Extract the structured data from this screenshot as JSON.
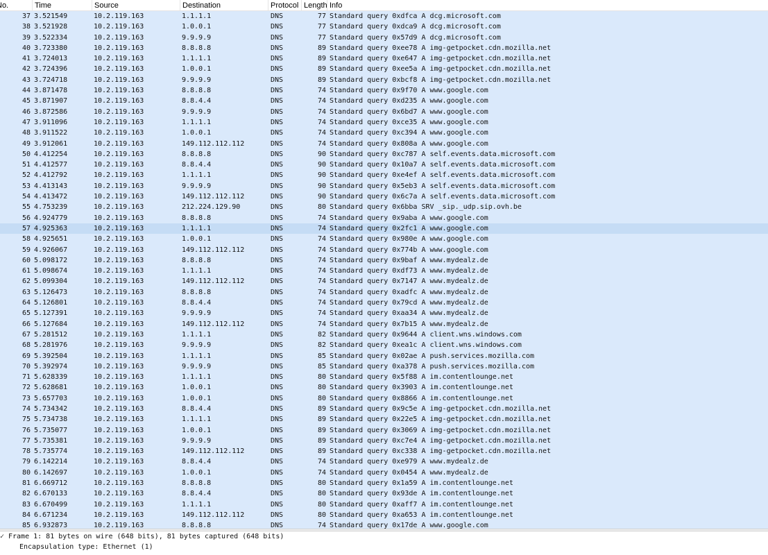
{
  "columns": {
    "no": "No.",
    "time": "Time",
    "source": "Source",
    "destination": "Destination",
    "protocol": "Protocol",
    "length": "Length",
    "info": "Info"
  },
  "packets": [
    {
      "no": "37",
      "time": "3.521549",
      "src": "10.2.119.163",
      "dst": "1.1.1.1",
      "proto": "DNS",
      "len": "77",
      "info": "Standard query 0xdfca A dcg.microsoft.com"
    },
    {
      "no": "38",
      "time": "3.521928",
      "src": "10.2.119.163",
      "dst": "1.0.0.1",
      "proto": "DNS",
      "len": "77",
      "info": "Standard query 0xdca9 A dcg.microsoft.com"
    },
    {
      "no": "39",
      "time": "3.522334",
      "src": "10.2.119.163",
      "dst": "9.9.9.9",
      "proto": "DNS",
      "len": "77",
      "info": "Standard query 0x57d9 A dcg.microsoft.com"
    },
    {
      "no": "40",
      "time": "3.723380",
      "src": "10.2.119.163",
      "dst": "8.8.8.8",
      "proto": "DNS",
      "len": "89",
      "info": "Standard query 0xee78 A img-getpocket.cdn.mozilla.net"
    },
    {
      "no": "41",
      "time": "3.724013",
      "src": "10.2.119.163",
      "dst": "1.1.1.1",
      "proto": "DNS",
      "len": "89",
      "info": "Standard query 0xe647 A img-getpocket.cdn.mozilla.net"
    },
    {
      "no": "42",
      "time": "3.724396",
      "src": "10.2.119.163",
      "dst": "1.0.0.1",
      "proto": "DNS",
      "len": "89",
      "info": "Standard query 0xee5a A img-getpocket.cdn.mozilla.net"
    },
    {
      "no": "43",
      "time": "3.724718",
      "src": "10.2.119.163",
      "dst": "9.9.9.9",
      "proto": "DNS",
      "len": "89",
      "info": "Standard query 0xbcf8 A img-getpocket.cdn.mozilla.net"
    },
    {
      "no": "44",
      "time": "3.871478",
      "src": "10.2.119.163",
      "dst": "8.8.8.8",
      "proto": "DNS",
      "len": "74",
      "info": "Standard query 0x9f70 A www.google.com"
    },
    {
      "no": "45",
      "time": "3.871907",
      "src": "10.2.119.163",
      "dst": "8.8.4.4",
      "proto": "DNS",
      "len": "74",
      "info": "Standard query 0xd235 A www.google.com"
    },
    {
      "no": "46",
      "time": "3.872586",
      "src": "10.2.119.163",
      "dst": "9.9.9.9",
      "proto": "DNS",
      "len": "74",
      "info": "Standard query 0x6bd7 A www.google.com"
    },
    {
      "no": "47",
      "time": "3.911096",
      "src": "10.2.119.163",
      "dst": "1.1.1.1",
      "proto": "DNS",
      "len": "74",
      "info": "Standard query 0xce35 A www.google.com"
    },
    {
      "no": "48",
      "time": "3.911522",
      "src": "10.2.119.163",
      "dst": "1.0.0.1",
      "proto": "DNS",
      "len": "74",
      "info": "Standard query 0xc394 A www.google.com"
    },
    {
      "no": "49",
      "time": "3.912061",
      "src": "10.2.119.163",
      "dst": "149.112.112.112",
      "proto": "DNS",
      "len": "74",
      "info": "Standard query 0x808a A www.google.com"
    },
    {
      "no": "50",
      "time": "4.412254",
      "src": "10.2.119.163",
      "dst": "8.8.8.8",
      "proto": "DNS",
      "len": "90",
      "info": "Standard query 0xc787 A self.events.data.microsoft.com"
    },
    {
      "no": "51",
      "time": "4.412577",
      "src": "10.2.119.163",
      "dst": "8.8.4.4",
      "proto": "DNS",
      "len": "90",
      "info": "Standard query 0x10a7 A self.events.data.microsoft.com"
    },
    {
      "no": "52",
      "time": "4.412792",
      "src": "10.2.119.163",
      "dst": "1.1.1.1",
      "proto": "DNS",
      "len": "90",
      "info": "Standard query 0xe4ef A self.events.data.microsoft.com"
    },
    {
      "no": "53",
      "time": "4.413143",
      "src": "10.2.119.163",
      "dst": "9.9.9.9",
      "proto": "DNS",
      "len": "90",
      "info": "Standard query 0x5eb3 A self.events.data.microsoft.com"
    },
    {
      "no": "54",
      "time": "4.413472",
      "src": "10.2.119.163",
      "dst": "149.112.112.112",
      "proto": "DNS",
      "len": "90",
      "info": "Standard query 0x6c7a A self.events.data.microsoft.com"
    },
    {
      "no": "55",
      "time": "4.753239",
      "src": "10.2.119.163",
      "dst": "212.224.129.90",
      "proto": "DNS",
      "len": "80",
      "info": "Standard query 0x6bba SRV _sip._udp.sip.ovh.be"
    },
    {
      "no": "56",
      "time": "4.924779",
      "src": "10.2.119.163",
      "dst": "8.8.8.8",
      "proto": "DNS",
      "len": "74",
      "info": "Standard query 0x9aba A www.google.com"
    },
    {
      "no": "57",
      "time": "4.925363",
      "src": "10.2.119.163",
      "dst": "1.1.1.1",
      "proto": "DNS",
      "len": "74",
      "info": "Standard query 0x2fc1 A www.google.com"
    },
    {
      "no": "58",
      "time": "4.925651",
      "src": "10.2.119.163",
      "dst": "1.0.0.1",
      "proto": "DNS",
      "len": "74",
      "info": "Standard query 0x980e A www.google.com"
    },
    {
      "no": "59",
      "time": "4.926067",
      "src": "10.2.119.163",
      "dst": "149.112.112.112",
      "proto": "DNS",
      "len": "74",
      "info": "Standard query 0x774b A www.google.com"
    },
    {
      "no": "60",
      "time": "5.098172",
      "src": "10.2.119.163",
      "dst": "8.8.8.8",
      "proto": "DNS",
      "len": "74",
      "info": "Standard query 0x9baf A www.mydealz.de"
    },
    {
      "no": "61",
      "time": "5.098674",
      "src": "10.2.119.163",
      "dst": "1.1.1.1",
      "proto": "DNS",
      "len": "74",
      "info": "Standard query 0xdf73 A www.mydealz.de"
    },
    {
      "no": "62",
      "time": "5.099304",
      "src": "10.2.119.163",
      "dst": "149.112.112.112",
      "proto": "DNS",
      "len": "74",
      "info": "Standard query 0x7147 A www.mydealz.de"
    },
    {
      "no": "63",
      "time": "5.126473",
      "src": "10.2.119.163",
      "dst": "8.8.8.8",
      "proto": "DNS",
      "len": "74",
      "info": "Standard query 0xadfc A www.mydealz.de"
    },
    {
      "no": "64",
      "time": "5.126801",
      "src": "10.2.119.163",
      "dst": "8.8.4.4",
      "proto": "DNS",
      "len": "74",
      "info": "Standard query 0x79cd A www.mydealz.de"
    },
    {
      "no": "65",
      "time": "5.127391",
      "src": "10.2.119.163",
      "dst": "9.9.9.9",
      "proto": "DNS",
      "len": "74",
      "info": "Standard query 0xaa34 A www.mydealz.de"
    },
    {
      "no": "66",
      "time": "5.127684",
      "src": "10.2.119.163",
      "dst": "149.112.112.112",
      "proto": "DNS",
      "len": "74",
      "info": "Standard query 0x7b15 A www.mydealz.de"
    },
    {
      "no": "67",
      "time": "5.281512",
      "src": "10.2.119.163",
      "dst": "1.1.1.1",
      "proto": "DNS",
      "len": "82",
      "info": "Standard query 0x9644 A client.wns.windows.com"
    },
    {
      "no": "68",
      "time": "5.281976",
      "src": "10.2.119.163",
      "dst": "9.9.9.9",
      "proto": "DNS",
      "len": "82",
      "info": "Standard query 0xea1c A client.wns.windows.com"
    },
    {
      "no": "69",
      "time": "5.392504",
      "src": "10.2.119.163",
      "dst": "1.1.1.1",
      "proto": "DNS",
      "len": "85",
      "info": "Standard query 0x02ae A push.services.mozilla.com"
    },
    {
      "no": "70",
      "time": "5.392974",
      "src": "10.2.119.163",
      "dst": "9.9.9.9",
      "proto": "DNS",
      "len": "85",
      "info": "Standard query 0xa378 A push.services.mozilla.com"
    },
    {
      "no": "71",
      "time": "5.628339",
      "src": "10.2.119.163",
      "dst": "1.1.1.1",
      "proto": "DNS",
      "len": "80",
      "info": "Standard query 0x5f88 A im.contentlounge.net"
    },
    {
      "no": "72",
      "time": "5.628681",
      "src": "10.2.119.163",
      "dst": "1.0.0.1",
      "proto": "DNS",
      "len": "80",
      "info": "Standard query 0x3903 A im.contentlounge.net"
    },
    {
      "no": "73",
      "time": "5.657703",
      "src": "10.2.119.163",
      "dst": "1.0.0.1",
      "proto": "DNS",
      "len": "80",
      "info": "Standard query 0x8866 A im.contentlounge.net"
    },
    {
      "no": "74",
      "time": "5.734342",
      "src": "10.2.119.163",
      "dst": "8.8.4.4",
      "proto": "DNS",
      "len": "89",
      "info": "Standard query 0x9c5e A img-getpocket.cdn.mozilla.net"
    },
    {
      "no": "75",
      "time": "5.734738",
      "src": "10.2.119.163",
      "dst": "1.1.1.1",
      "proto": "DNS",
      "len": "89",
      "info": "Standard query 0x22e5 A img-getpocket.cdn.mozilla.net"
    },
    {
      "no": "76",
      "time": "5.735077",
      "src": "10.2.119.163",
      "dst": "1.0.0.1",
      "proto": "DNS",
      "len": "89",
      "info": "Standard query 0x3069 A img-getpocket.cdn.mozilla.net"
    },
    {
      "no": "77",
      "time": "5.735381",
      "src": "10.2.119.163",
      "dst": "9.9.9.9",
      "proto": "DNS",
      "len": "89",
      "info": "Standard query 0xc7e4 A img-getpocket.cdn.mozilla.net"
    },
    {
      "no": "78",
      "time": "5.735774",
      "src": "10.2.119.163",
      "dst": "149.112.112.112",
      "proto": "DNS",
      "len": "89",
      "info": "Standard query 0xc338 A img-getpocket.cdn.mozilla.net"
    },
    {
      "no": "79",
      "time": "6.142214",
      "src": "10.2.119.163",
      "dst": "8.8.4.4",
      "proto": "DNS",
      "len": "74",
      "info": "Standard query 0xe979 A www.mydealz.de"
    },
    {
      "no": "80",
      "time": "6.142697",
      "src": "10.2.119.163",
      "dst": "1.0.0.1",
      "proto": "DNS",
      "len": "74",
      "info": "Standard query 0x0454 A www.mydealz.de"
    },
    {
      "no": "81",
      "time": "6.669712",
      "src": "10.2.119.163",
      "dst": "8.8.8.8",
      "proto": "DNS",
      "len": "80",
      "info": "Standard query 0x1a59 A im.contentlounge.net"
    },
    {
      "no": "82",
      "time": "6.670133",
      "src": "10.2.119.163",
      "dst": "8.8.4.4",
      "proto": "DNS",
      "len": "80",
      "info": "Standard query 0x93de A im.contentlounge.net"
    },
    {
      "no": "83",
      "time": "6.670499",
      "src": "10.2.119.163",
      "dst": "1.1.1.1",
      "proto": "DNS",
      "len": "80",
      "info": "Standard query 0xaff7 A im.contentlounge.net"
    },
    {
      "no": "84",
      "time": "6.671234",
      "src": "10.2.119.163",
      "dst": "149.112.112.112",
      "proto": "DNS",
      "len": "80",
      "info": "Standard query 0xa653 A im.contentlounge.net"
    },
    {
      "no": "85",
      "time": "6.932873",
      "src": "10.2.119.163",
      "dst": "8.8.8.8",
      "proto": "DNS",
      "len": "74",
      "info": "Standard query 0x17de A www.google.com"
    }
  ],
  "selected_no": "57",
  "details": {
    "frame_line": "Frame 1: 81 bytes on wire (648 bits), 81 bytes captured (648 bits)",
    "encapsulation_line": "Encapsulation type: Ethernet (1)",
    "expand_glyph": "✓"
  },
  "colors": {
    "row_bg": "#dae9fb",
    "selected_bg": "#c5dcf5"
  }
}
